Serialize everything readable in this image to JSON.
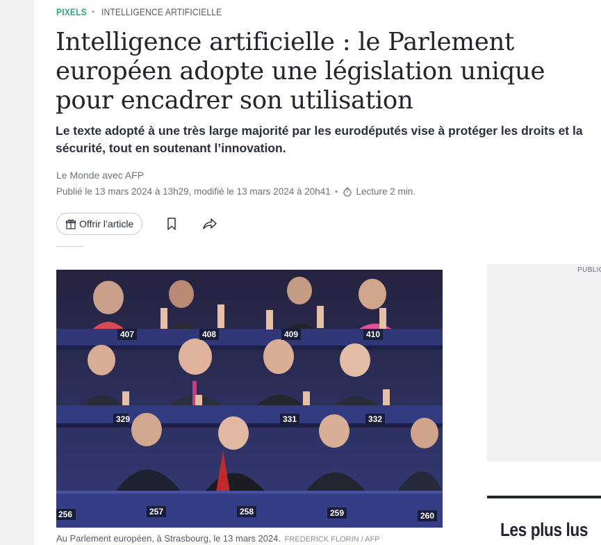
{
  "kicker": {
    "section": "PIXELS",
    "separator": "•",
    "topic": "INTELLIGENCE ARTIFICIELLE"
  },
  "article": {
    "title": "Intelligence artificielle : le Parlement européen adopte une législation unique pour encadrer son utilisation",
    "dek": "Le texte adopté à une très large majorité par les eurodéputés vise à protéger les droits et la sécurité, tout en soutenant l’innovation.",
    "byline": "Le Monde avec AFP",
    "published": "Publié le 13 mars 2024 à 13h29, modifié le 13 mars 2024 à 20h41",
    "separator": "•",
    "reading_time": "Lecture 2 min."
  },
  "actions": {
    "gift_label": "Offrir l’article"
  },
  "photo": {
    "seat_numbers": [
      "407",
      "408",
      "409",
      "410",
      "329",
      "331",
      "332",
      "256",
      "257",
      "258",
      "259",
      "260"
    ],
    "caption": "Au Parlement européen, à Strasbourg, le 13 mars 2024.",
    "credit": "FREDERICK FLORIN / AFP"
  },
  "sidebar": {
    "ad_label": "PUBLICITÉ",
    "most_read_title": "Les plus lus"
  },
  "icons": {
    "gift": "gift-icon",
    "bookmark": "bookmark-icon",
    "share": "share-icon",
    "clock": "timer-icon"
  },
  "colors": {
    "section_accent": "#2eaa7c",
    "text_primary": "#22252b",
    "text_muted": "#6b7280"
  }
}
